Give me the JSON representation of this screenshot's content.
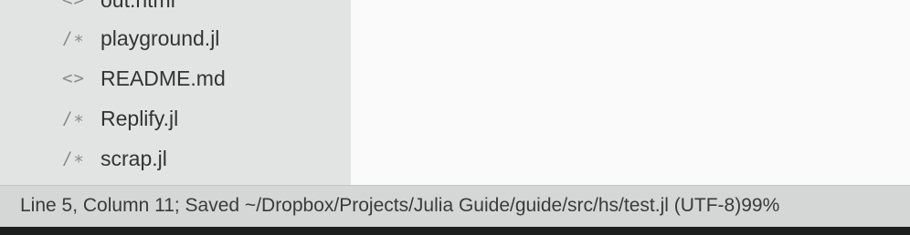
{
  "sidebar": {
    "items": [
      {
        "icon": "<>",
        "icon_name": "html-file-icon",
        "label": "out.html"
      },
      {
        "icon": "/∗",
        "icon_name": "julia-file-icon",
        "label": "playground.jl"
      },
      {
        "icon": "<>",
        "icon_name": "markdown-file-icon",
        "label": "README.md"
      },
      {
        "icon": "/∗",
        "icon_name": "julia-file-icon",
        "label": "Replify.jl"
      },
      {
        "icon": "/∗",
        "icon_name": "julia-file-icon",
        "label": "scrap.jl"
      }
    ]
  },
  "statusbar": {
    "text": "Line 5, Column 11; Saved ~/Dropbox/Projects/Julia Guide/guide/src/hs/test.jl (UTF-8)99%"
  },
  "colors": {
    "sidebar_bg": "#e2e3e3",
    "editor_bg": "#fafafa",
    "statusbar_bg": "#d5d6d6"
  }
}
